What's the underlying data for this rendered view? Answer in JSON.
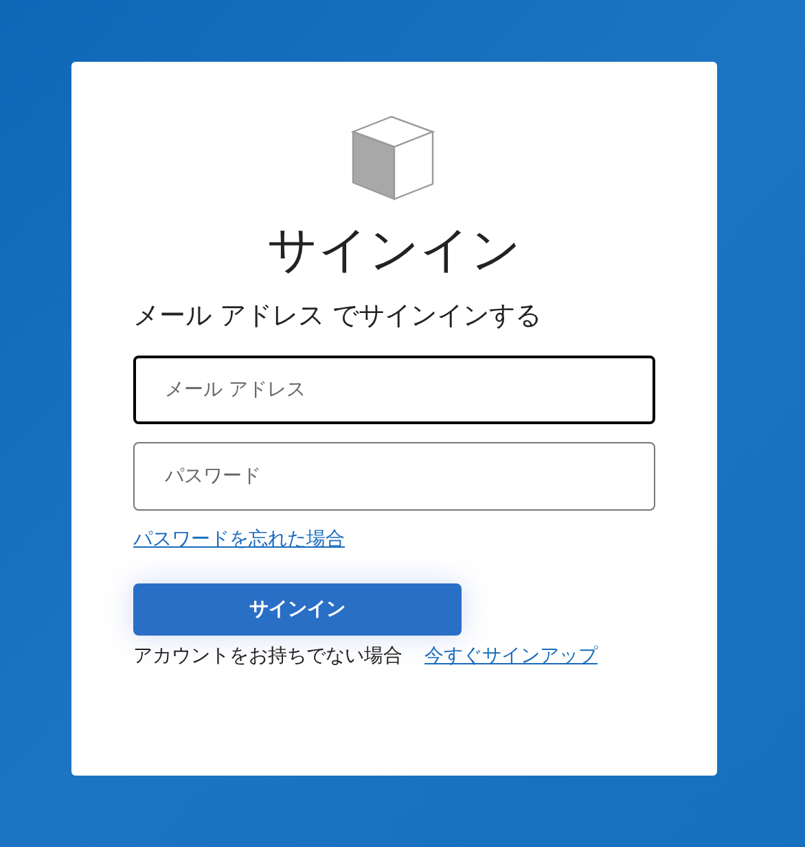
{
  "title": "サインイン",
  "subtitle": "メール アドレス でサインインする",
  "fields": [
    {
      "placeholder": "メール アドレス",
      "focused": true
    },
    {
      "placeholder": "パスワード",
      "focused": false
    }
  ],
  "forgot_link": "パスワードを忘れた場合",
  "submit_button": "サインイン",
  "signup_prompt": "アカウントをお持ちでない場合",
  "signup_link": "今すぐサインアップ"
}
